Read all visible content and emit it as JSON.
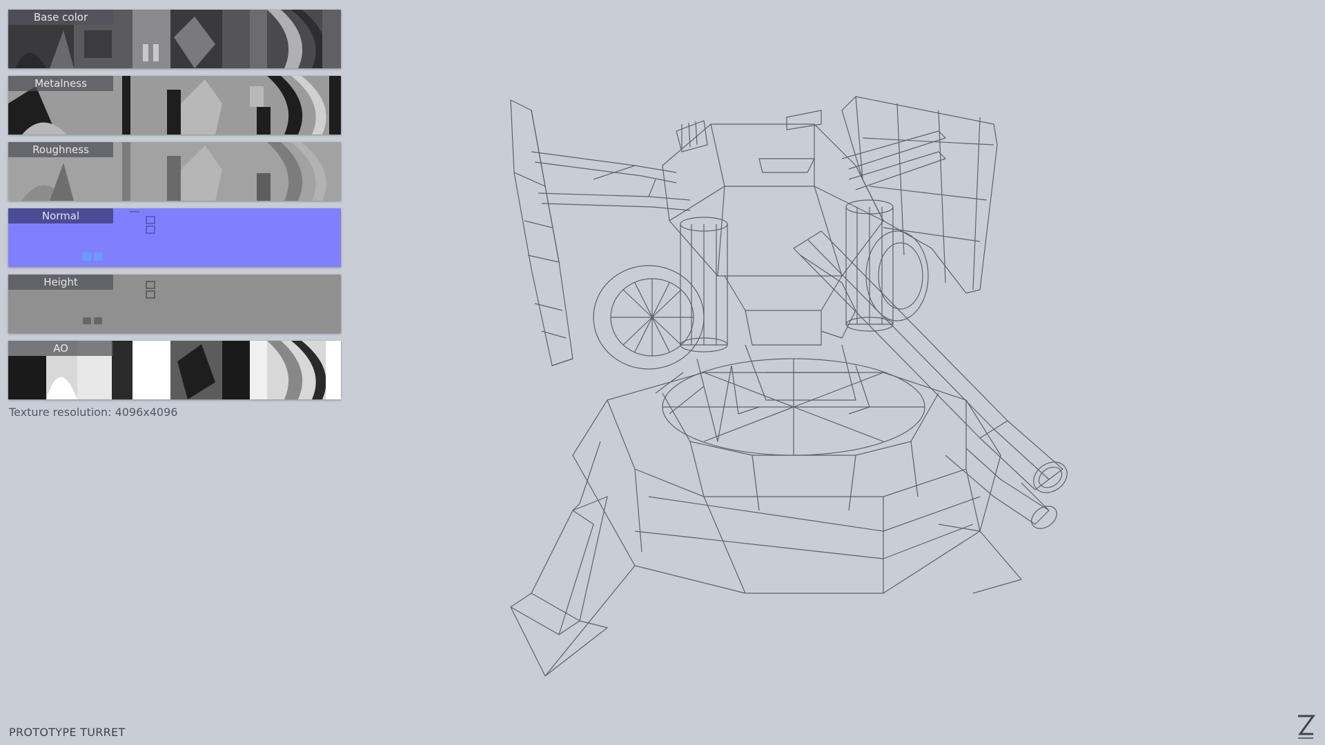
{
  "texture_panels": [
    {
      "label": "Base color",
      "kind": "basecolor"
    },
    {
      "label": "Metalness",
      "kind": "metal"
    },
    {
      "label": "Roughness",
      "kind": "rough"
    },
    {
      "label": "Normal",
      "kind": "normal"
    },
    {
      "label": "Height",
      "kind": "height"
    },
    {
      "label": "AO",
      "kind": "ao"
    }
  ],
  "resolution_text": "Texture resolution: 4096x4096",
  "model_title": "PROTOTYPE TURRET",
  "colors": {
    "background": "#c9cdd6",
    "normal_map": "#8080ff",
    "wire": "#5d6068"
  },
  "icons": {
    "logo": "z-logo-icon"
  }
}
